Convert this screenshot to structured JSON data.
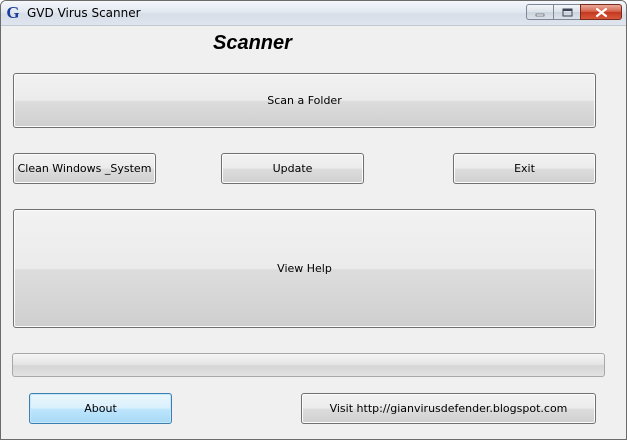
{
  "window": {
    "title": "GVD Virus Scanner",
    "icon": "G",
    "controls": [
      "minimize-icon",
      "maximize-icon",
      "close-icon"
    ]
  },
  "main": {
    "heading": "Scanner",
    "progress": {
      "value": 0
    }
  },
  "buttons": {
    "scan_folder": "Scan a Folder",
    "clean_system": "Clean Windows _System",
    "update": "Update",
    "exit": "Exit",
    "view_help": "View Help",
    "about": "About",
    "visit": "Visit http://gianvirusdefender.blogspot.com"
  },
  "colors": {
    "window_bg": "#f0f0f0",
    "focus_border": "#3c7fb1",
    "close_button": "#c4391f"
  }
}
